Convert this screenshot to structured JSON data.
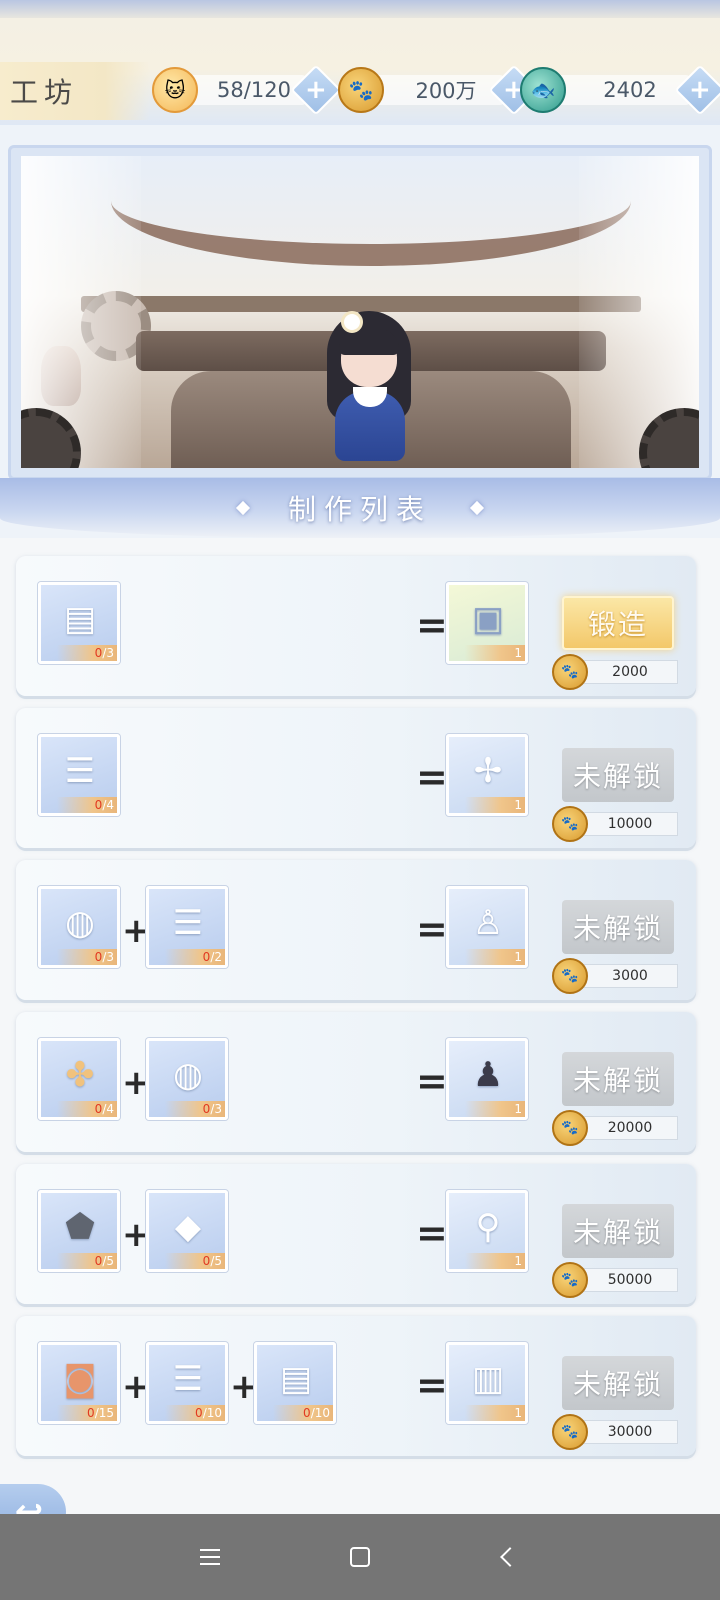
{
  "header": {
    "title": "工坊",
    "resources": [
      {
        "name": "stamina",
        "icon": "cat-icon",
        "value": "58/120"
      },
      {
        "name": "coins",
        "icon": "paw-coin-icon",
        "value": "200万"
      },
      {
        "name": "fish",
        "icon": "fish-icon",
        "value": "2402"
      }
    ]
  },
  "section": {
    "title": "制作列表"
  },
  "recipes": [
    {
      "inputs": [
        {
          "icon": "cloth-stack-icon",
          "have": "0",
          "need": "/3"
        }
      ],
      "output": {
        "icon": "portrait-frame-icon",
        "qty": "1"
      },
      "action": "锻造",
      "state": "available",
      "cost": "2000"
    },
    {
      "inputs": [
        {
          "icon": "ingot-stack-icon",
          "have": "0",
          "need": "/4"
        }
      ],
      "output": {
        "icon": "pinwheel-icon",
        "qty": "1"
      },
      "action": "未解锁",
      "state": "locked",
      "cost": "10000"
    },
    {
      "inputs": [
        {
          "icon": "fabric-roll-icon",
          "have": "0",
          "need": "/3"
        },
        {
          "icon": "ingot-stack-icon",
          "have": "0",
          "need": "/2"
        }
      ],
      "output": {
        "icon": "figurine-white-icon",
        "qty": "1"
      },
      "action": "未解锁",
      "state": "locked",
      "cost": "3000"
    },
    {
      "inputs": [
        {
          "icon": "wood-bundle-icon",
          "have": "0",
          "need": "/4"
        },
        {
          "icon": "fabric-roll-icon",
          "have": "0",
          "need": "/3"
        }
      ],
      "output": {
        "icon": "figurine-scholar-icon",
        "qty": "1"
      },
      "action": "未解锁",
      "state": "locked",
      "cost": "20000"
    },
    {
      "inputs": [
        {
          "icon": "ore-rock-icon",
          "have": "0",
          "need": "/5"
        },
        {
          "icon": "crystal-cube-icon",
          "have": "0",
          "need": "/5"
        }
      ],
      "output": {
        "icon": "hand-mirror-icon",
        "qty": "1"
      },
      "action": "未解锁",
      "state": "locked",
      "cost": "50000"
    },
    {
      "inputs": [
        {
          "icon": "wooden-bucket-icon",
          "have": "0",
          "need": "/15"
        },
        {
          "icon": "ingot-stack-icon",
          "have": "0",
          "need": "/10"
        },
        {
          "icon": "cloth-stack-icon",
          "have": "0",
          "need": "/10"
        }
      ],
      "output": {
        "icon": "bookshelf-icon",
        "qty": "1"
      },
      "action": "未解锁",
      "state": "locked",
      "cost": "30000"
    }
  ],
  "operators": {
    "plus": "+",
    "equals": "="
  }
}
